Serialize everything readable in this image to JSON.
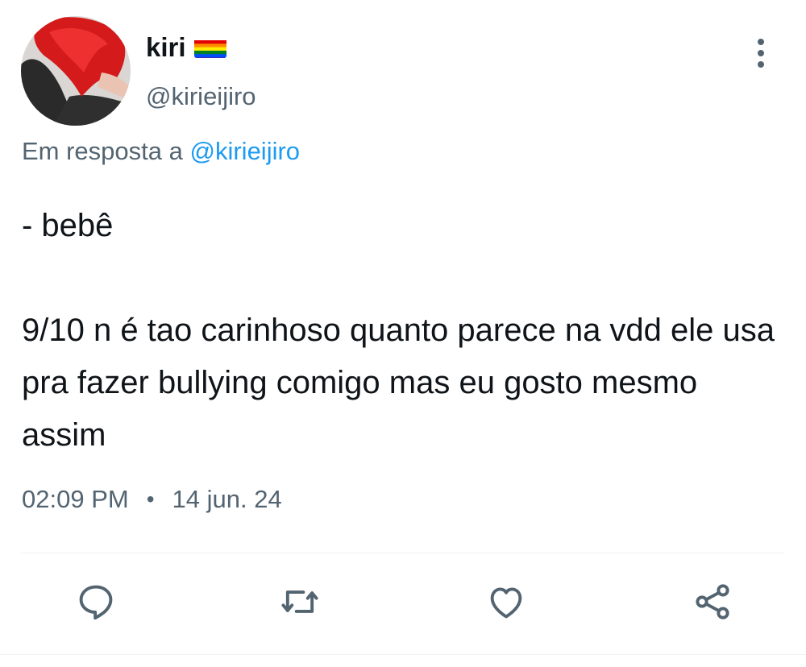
{
  "tweet": {
    "author": {
      "display_name": "kiri",
      "handle": "@kirieijiro",
      "flag": "rainbow-flag"
    },
    "reply_prefix": "Em resposta a",
    "reply_to": "@kirieijiro",
    "text": {
      "line1": "- bebê",
      "paragraph2": "9/10 n é tao carinhoso quanto parece na vdd ele usa pra fazer bullying comigo mas eu gosto mesmo assim"
    },
    "time": "02:09 PM",
    "separator": "•",
    "date": "14 jun. 24"
  },
  "actions": {
    "icons": [
      "reply-icon",
      "retweet-icon",
      "like-icon",
      "share-icon"
    ]
  },
  "colors": {
    "text_primary": "#0f1419",
    "text_secondary": "#536471",
    "link": "#1d9bf0",
    "icon": "#536471"
  }
}
